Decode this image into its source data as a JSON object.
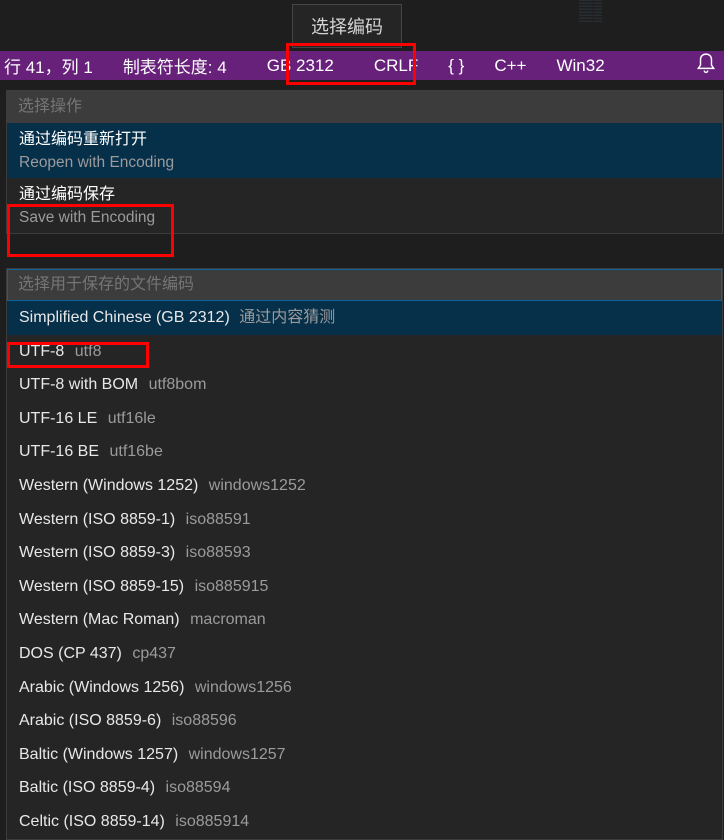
{
  "tooltip": "选择编码",
  "statusbar": {
    "cursor": "行 41，列 1",
    "tab_size": "制表符长度: 4",
    "encoding": "GB 2312",
    "eol": "CRLF",
    "braces": "{ }",
    "language": "C++",
    "target": "Win32"
  },
  "action_picker": {
    "placeholder": "选择操作",
    "options": [
      {
        "primary": "通过编码重新打开",
        "secondary": "Reopen with Encoding"
      },
      {
        "primary": "通过编码保存",
        "secondary": "Save with Encoding"
      }
    ]
  },
  "encoding_picker": {
    "placeholder": "选择用于保存的文件编码",
    "hint_guessed": "通过内容猜测",
    "encodings": [
      {
        "name": "Simplified Chinese (GB 2312)",
        "alias": "",
        "guessed": true
      },
      {
        "name": "UTF-8",
        "alias": "utf8"
      },
      {
        "name": "UTF-8 with BOM",
        "alias": "utf8bom"
      },
      {
        "name": "UTF-16 LE",
        "alias": "utf16le"
      },
      {
        "name": "UTF-16 BE",
        "alias": "utf16be"
      },
      {
        "name": "Western (Windows 1252)",
        "alias": "windows1252"
      },
      {
        "name": "Western (ISO 8859-1)",
        "alias": "iso88591"
      },
      {
        "name": "Western (ISO 8859-3)",
        "alias": "iso88593"
      },
      {
        "name": "Western (ISO 8859-15)",
        "alias": "iso885915"
      },
      {
        "name": "Western (Mac Roman)",
        "alias": "macroman"
      },
      {
        "name": "DOS (CP 437)",
        "alias": "cp437"
      },
      {
        "name": "Arabic (Windows 1256)",
        "alias": "windows1256"
      },
      {
        "name": "Arabic (ISO 8859-6)",
        "alias": "iso88596"
      },
      {
        "name": "Baltic (Windows 1257)",
        "alias": "windows1257"
      },
      {
        "name": "Baltic (ISO 8859-4)",
        "alias": "iso88594"
      },
      {
        "name": "Celtic (ISO 8859-14)",
        "alias": "iso885914"
      }
    ]
  }
}
